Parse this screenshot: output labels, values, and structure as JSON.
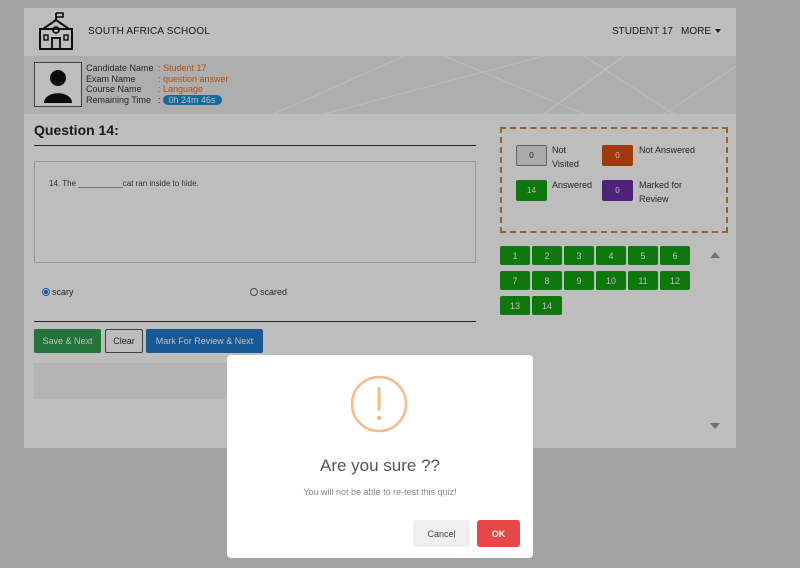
{
  "header": {
    "school_name": "SOUTH AFRICA SCHOOL",
    "user_name": "STUDENT 17",
    "more_label": "MORE",
    "logo_icon": "school-building-icon"
  },
  "candidate": {
    "avatar_icon": "user-avatar-icon",
    "rows": [
      {
        "label": "Candidate Name",
        "value": ": Student 17"
      },
      {
        "label": "Exam Name",
        "value": ": question answer"
      },
      {
        "label": "Course Name",
        "value": ": Language"
      },
      {
        "label": "Remaining Time",
        "value": ":"
      }
    ],
    "remaining_time": "0h 24m 46s"
  },
  "question": {
    "title": "Question 14:",
    "text": "14. The __________cat ran inside to hide.",
    "options": [
      {
        "label": "scary",
        "selected": true
      },
      {
        "label": "scared",
        "selected": false
      }
    ]
  },
  "actions": {
    "save_next": "Save & Next",
    "clear": "Clear",
    "mark_review_next": "Mark For Review & Next"
  },
  "legend": {
    "not_visited": {
      "count": "0",
      "label": "Not Visited",
      "color": "#e6e6e6"
    },
    "not_answered": {
      "count": "0",
      "label": "Not Answered",
      "color": "#d84d0f"
    },
    "answered": {
      "count": "14",
      "label": "Answered",
      "color": "#12a012"
    },
    "marked_review": {
      "count": "0",
      "label": "Marked for Review",
      "color": "#6a2fa3"
    }
  },
  "palette": {
    "color": "#12a012",
    "numbers": [
      "1",
      "2",
      "3",
      "4",
      "5",
      "6",
      "7",
      "8",
      "9",
      "10",
      "11",
      "12",
      "13",
      "14"
    ]
  },
  "modal": {
    "icon": "warning-exclamation-icon",
    "title": "Are you sure ??",
    "text": "You will not be able to re-test this quiz!",
    "cancel_label": "Cancel",
    "ok_label": "OK",
    "ok_color": "#e84747"
  }
}
